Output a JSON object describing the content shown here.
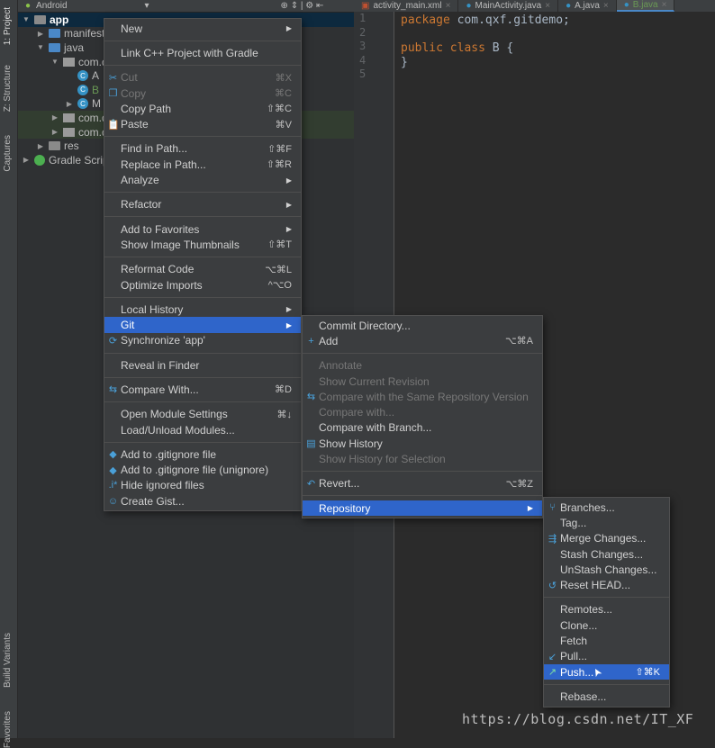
{
  "sidebar": {
    "tabs": [
      "1: Project",
      "Z: Structure",
      "Captures",
      "Build Variants",
      "Favorites"
    ]
  },
  "project": {
    "view": "Android",
    "tree": [
      {
        "label": "app",
        "level": 0,
        "icon": "module",
        "open": true
      },
      {
        "label": "manifests",
        "level": 1,
        "icon": "folder",
        "open": false
      },
      {
        "label": "java",
        "level": 1,
        "icon": "folder",
        "open": true
      },
      {
        "label": "com.q",
        "level": 2,
        "icon": "package",
        "open": true
      },
      {
        "label": "A",
        "level": 3,
        "icon": "class"
      },
      {
        "label": "B",
        "level": 3,
        "icon": "class"
      },
      {
        "label": "M",
        "level": 3,
        "icon": "class",
        "open": false
      },
      {
        "label": "com.q",
        "level": 2,
        "icon": "package",
        "open": false
      },
      {
        "label": "com.q",
        "level": 2,
        "icon": "package",
        "open": false
      },
      {
        "label": "res",
        "level": 1,
        "icon": "res-folder",
        "open": false
      },
      {
        "label": "Gradle Scripts",
        "level": 0,
        "icon": "gradle",
        "open": false
      }
    ]
  },
  "editor": {
    "tabs": [
      "activity_main.xml",
      "MainActivity.java",
      "A.java",
      "B.java"
    ],
    "active_tab": 3,
    "lines": [
      "1",
      "2",
      "3",
      "4",
      "5"
    ],
    "code": {
      "l1a": "package",
      "l1b": " com.qxf.gitdemo;",
      "l3a": "public class",
      "l3b": " B {",
      "l4": "}"
    }
  },
  "context_menu": [
    {
      "label": "New",
      "sub": true
    },
    {
      "sep": true
    },
    {
      "label": "Link C++ Project with Gradle"
    },
    {
      "sep": true
    },
    {
      "label": "Cut",
      "sc": "⌘X",
      "dis": true,
      "icon": "✂"
    },
    {
      "label": "Copy",
      "sc": "⌘C",
      "dis": true,
      "icon": "❐"
    },
    {
      "label": "Copy Path",
      "sc": "⇧⌘C"
    },
    {
      "label": "Paste",
      "sc": "⌘V",
      "icon": "📋"
    },
    {
      "sep": true
    },
    {
      "label": "Find in Path...",
      "sc": "⇧⌘F"
    },
    {
      "label": "Replace in Path...",
      "sc": "⇧⌘R"
    },
    {
      "label": "Analyze",
      "sub": true
    },
    {
      "sep": true
    },
    {
      "label": "Refactor",
      "sub": true
    },
    {
      "sep": true
    },
    {
      "label": "Add to Favorites",
      "sub": true
    },
    {
      "label": "Show Image Thumbnails",
      "sc": "⇧⌘T"
    },
    {
      "sep": true
    },
    {
      "label": "Reformat Code",
      "sc": "⌥⌘L"
    },
    {
      "label": "Optimize Imports",
      "sc": "^⌥O"
    },
    {
      "sep": true
    },
    {
      "label": "Local History",
      "sub": true
    },
    {
      "label": "Git",
      "sub": true,
      "sel": true
    },
    {
      "label": "Synchronize 'app'",
      "icon": "⟳"
    },
    {
      "sep": true
    },
    {
      "label": "Reveal in Finder"
    },
    {
      "sep": true
    },
    {
      "label": "Compare With...",
      "sc": "⌘D",
      "icon": "⇆"
    },
    {
      "sep": true
    },
    {
      "label": "Open Module Settings",
      "sc": "⌘↓"
    },
    {
      "label": "Load/Unload Modules..."
    },
    {
      "sep": true
    },
    {
      "label": "Add to .gitignore file",
      "icon": "◆"
    },
    {
      "label": "Add to .gitignore file (unignore)",
      "icon": "◆"
    },
    {
      "label": "Hide ignored files",
      "icon": ".i*"
    },
    {
      "label": "Create Gist...",
      "icon": "☺"
    }
  ],
  "git_menu": [
    {
      "label": "Commit Directory..."
    },
    {
      "label": "Add",
      "sc": "⌥⌘A",
      "icon": "+"
    },
    {
      "sep": true
    },
    {
      "label": "Annotate",
      "dis": true
    },
    {
      "label": "Show Current Revision",
      "dis": true
    },
    {
      "label": "Compare with the Same Repository Version",
      "dis": true,
      "icon": "⇆"
    },
    {
      "label": "Compare with...",
      "dis": true
    },
    {
      "label": "Compare with Branch..."
    },
    {
      "label": "Show History",
      "icon": "▤"
    },
    {
      "label": "Show History for Selection",
      "dis": true
    },
    {
      "sep": true
    },
    {
      "label": "Revert...",
      "sc": "⌥⌘Z",
      "icon": "↶"
    },
    {
      "sep": true
    },
    {
      "label": "Repository",
      "sub": true,
      "sel": true
    }
  ],
  "repo_menu": [
    {
      "label": "Branches...",
      "icon": "⑂"
    },
    {
      "label": "Tag..."
    },
    {
      "label": "Merge Changes...",
      "icon": "⇶"
    },
    {
      "label": "Stash Changes..."
    },
    {
      "label": "UnStash Changes..."
    },
    {
      "label": "Reset HEAD...",
      "icon": "↺"
    },
    {
      "sep": true
    },
    {
      "label": "Remotes..."
    },
    {
      "label": "Clone..."
    },
    {
      "label": "Fetch"
    },
    {
      "label": "Pull...",
      "icon": "↙"
    },
    {
      "label": "Push...",
      "sc": "⇧⌘K",
      "sel": true,
      "icon": "↗"
    },
    {
      "sep": true
    },
    {
      "label": "Rebase..."
    }
  ],
  "watermark": "https://blog.csdn.net/IT_XF",
  "colors": {
    "selection": "#2f65ca",
    "keyword": "#cc7832",
    "code": "#a9b7c6"
  }
}
